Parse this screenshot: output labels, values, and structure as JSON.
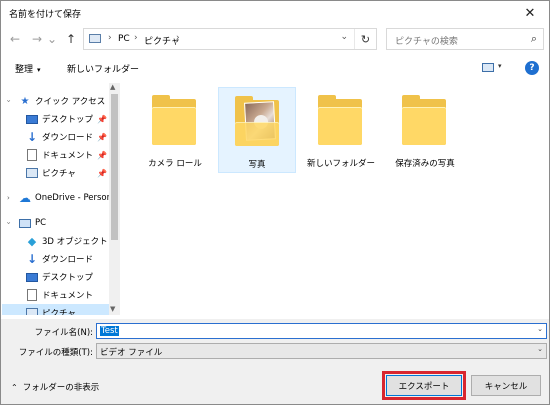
{
  "window": {
    "title": "名前を付けて保存",
    "close_glyph": "✕"
  },
  "nav": {
    "back_glyph": "←",
    "forward_glyph": "→",
    "dropdown_glyph": "⌄",
    "up_glyph": "↑"
  },
  "address": {
    "crumbs": [
      "PC",
      "ピクチャ"
    ],
    "sep": "›",
    "dropdown": "⌄",
    "refresh_glyph": "↻"
  },
  "search": {
    "placeholder": "ピクチャの検索",
    "icon_glyph": "⌕"
  },
  "toolbar": {
    "organize_label": "整理",
    "organize_arrow": "▾",
    "new_folder_label": "新しいフォルダー",
    "view_arrow": "▾",
    "help_label": "?"
  },
  "navpane": {
    "quick_access": "クイック アクセス",
    "desktop": "デスクトップ",
    "downloads": "ダウンロード",
    "documents": "ドキュメント",
    "pictures": "ピクチャ",
    "onedrive": "OneDrive - Persor",
    "pc": "PC",
    "objects3d": "3D オブジェクト",
    "downloads2": "ダウンロード",
    "desktop2": "デスクトップ",
    "documents2": "ドキュメント",
    "pictures2": "ピクチャ",
    "pin_glyph": "📌",
    "chevron_glyph": "›",
    "scroll_up": "▲",
    "scroll_down": "▼"
  },
  "files": [
    {
      "name": "カメラ ロール",
      "selected": false
    },
    {
      "name": "写真",
      "selected": true
    },
    {
      "name": "新しいフォルダー",
      "selected": false
    },
    {
      "name": "保存済みの写真",
      "selected": false
    }
  ],
  "filename": {
    "label": "ファイル名(N):",
    "value": "Test",
    "arrow": "⌄"
  },
  "filetype": {
    "label": "ファイルの種類(T):",
    "value": "ビデオ ファイル",
    "arrow": "⌄"
  },
  "footer": {
    "hide_folders": "フォルダーの非表示",
    "hide_chevron": "⌃",
    "export_label": "エクスポート",
    "cancel_label": "キャンセル"
  },
  "colors": {
    "accent": "#0078d7",
    "highlight_box": "#d8262f",
    "folder": "#ffd866",
    "selection": "#cce8ff"
  }
}
